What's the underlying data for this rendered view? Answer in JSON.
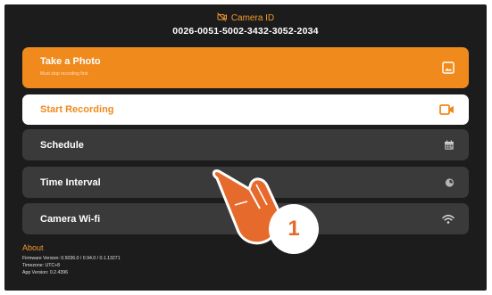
{
  "header": {
    "title": "Camera ID",
    "camera_id": "0026-0051-5002-3432-3052-2034"
  },
  "menu": {
    "take_photo": {
      "label": "Take a Photo",
      "sublabel": "Must stop recording first"
    },
    "start_recording": {
      "label": "Start Recording"
    },
    "schedule": {
      "label": "Schedule"
    },
    "time_interval": {
      "label": "Time Interval"
    },
    "camera_wifi": {
      "label": "Camera Wi-fi"
    }
  },
  "about": {
    "title": "About",
    "firmware": "Firmware Version: 0.5036.0 / 0.94.0 / 0.1.13271",
    "timezone": "Timezone: UTC+8",
    "app_version": "App Version: 0.2.4396"
  },
  "annotation": {
    "step_number": "1"
  },
  "colors": {
    "accent": "#f08a1d",
    "background": "#1c1c1c",
    "row": "#3a3a3a",
    "white": "#ffffff"
  },
  "icons": {
    "header": "camera-off-icon",
    "photo": "image-icon",
    "recording": "video-camera-icon",
    "schedule": "calendar-icon",
    "time_interval": "timer-icon",
    "wifi": "wifi-icon",
    "pointer": "pointing-hand-icon"
  }
}
